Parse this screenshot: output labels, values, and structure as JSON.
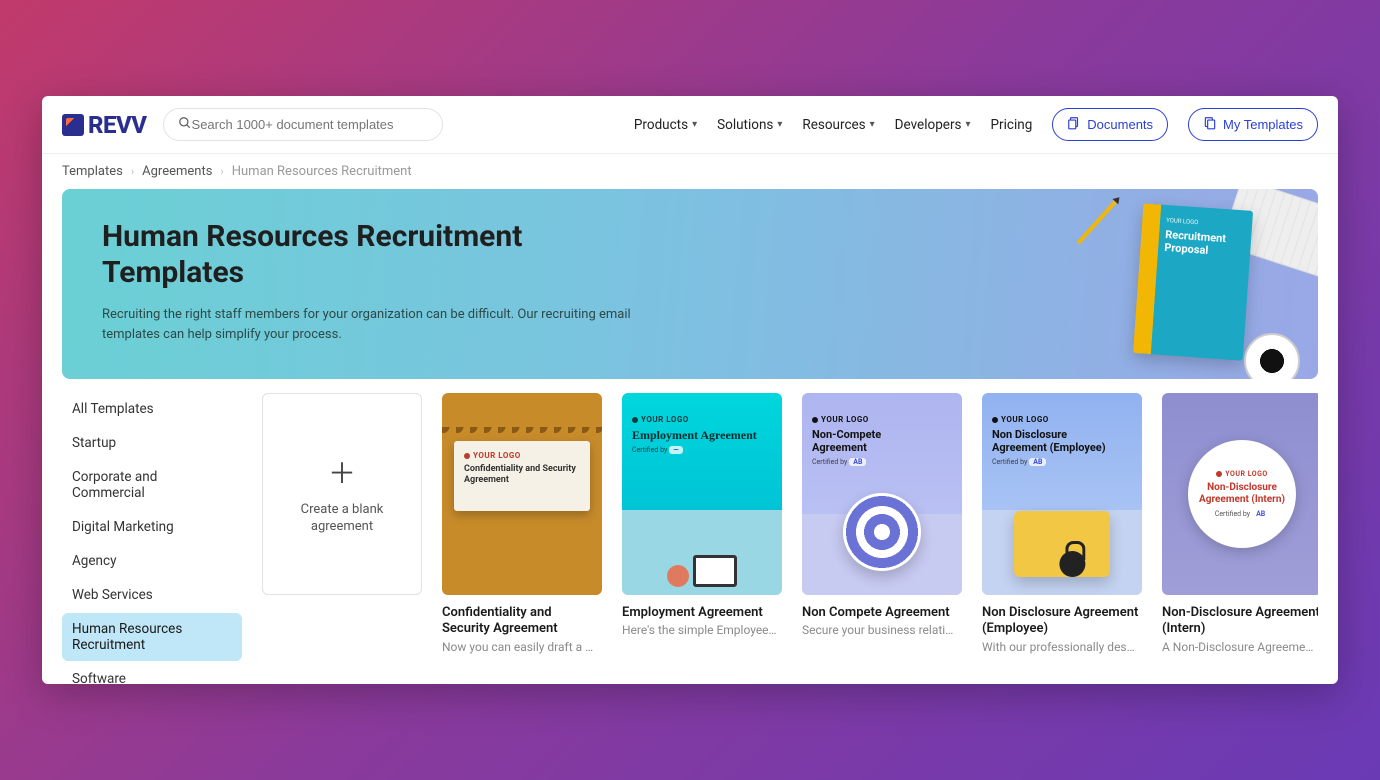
{
  "brand": "REVV",
  "search": {
    "placeholder": "Search 1000+ document templates"
  },
  "nav": {
    "products": "Products",
    "solutions": "Solutions",
    "resources": "Resources",
    "developers": "Developers",
    "pricing": "Pricing",
    "documents": "Documents",
    "my_templates": "My Templates"
  },
  "breadcrumb": {
    "root": "Templates",
    "mid": "Agreements",
    "current": "Human Resources Recruitment"
  },
  "hero": {
    "title": "Human Resources Recruitment Templates",
    "subtitle": "Recruiting the right staff members for your organization can be difficult. Our recruiting email templates can help simplify your process.",
    "doc_logo": "YOUR LOGO",
    "doc_title": "Recruitment Proposal"
  },
  "sidebar": [
    "All Templates",
    "Startup",
    "Corporate and Commercial",
    "Digital Marketing",
    "Agency",
    "Web Services",
    "Human Resources Recruitment",
    "Software"
  ],
  "sidebar_active_index": 6,
  "create_card": {
    "label": "Create a blank agreement"
  },
  "labels": {
    "your_logo": "YOUR LOGO",
    "certified": "Certified by"
  },
  "cards": [
    {
      "title": "Confidentiality and Security Agreement",
      "desc": "Now you can easily draft a …",
      "thumb_title": "Confidentiality and Security Agreement"
    },
    {
      "title": "Employment Agreement",
      "desc": "Here's the simple Employee…",
      "thumb_title": "Employment Agreement"
    },
    {
      "title": "Non Compete Agreement",
      "desc": "Secure your business relati…",
      "thumb_title": "Non-Compete Agreement"
    },
    {
      "title": "Non Disclosure Agreement (Employee)",
      "desc": "With our professionally des…",
      "thumb_title": "Non Disclosure Agreement (Employee)"
    },
    {
      "title": "Non-Disclosure Agreement (Intern)",
      "desc": "A Non-Disclosure Agreeme…",
      "thumb_title": "Non-Disclosure Agreement (Intern)"
    }
  ]
}
